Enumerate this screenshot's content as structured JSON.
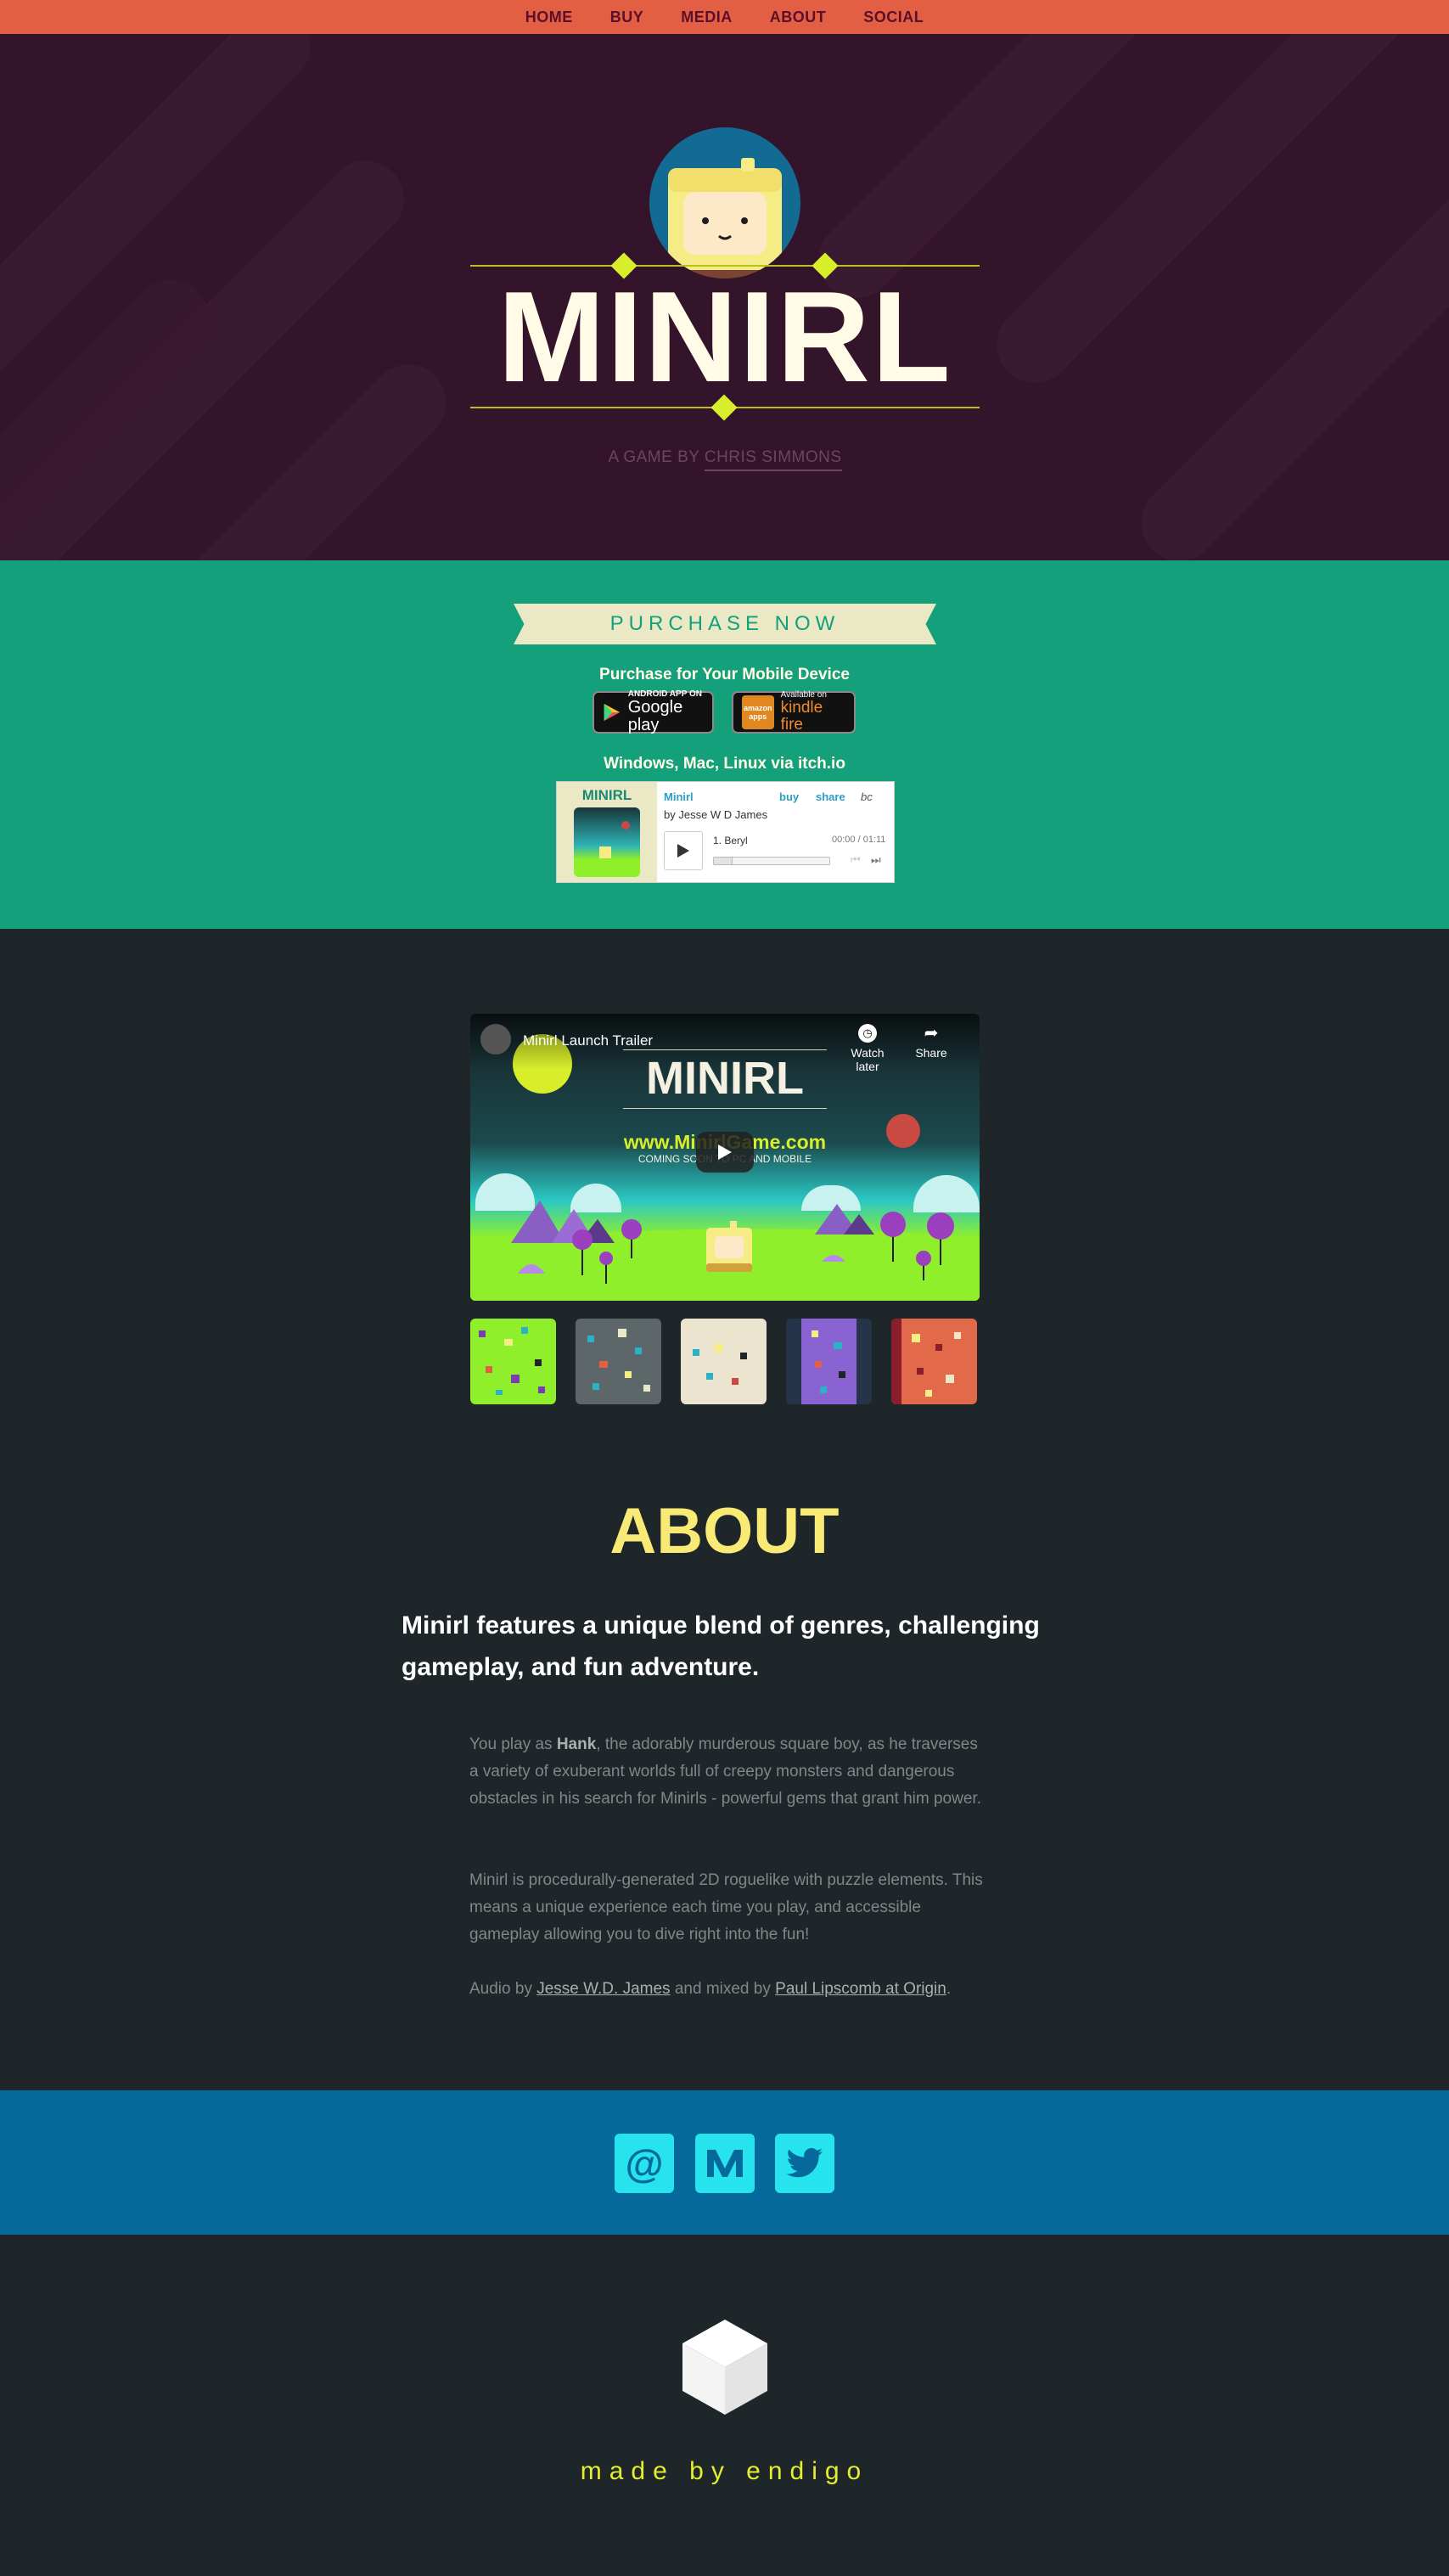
{
  "nav": {
    "items": [
      {
        "label": "HOME"
      },
      {
        "label": "BUY"
      },
      {
        "label": "MEDIA"
      },
      {
        "label": "ABOUT"
      },
      {
        "label": "SOCIAL"
      }
    ]
  },
  "hero": {
    "title": "MINIRL",
    "byline_prefix": "A GAME BY",
    "byline_author": "CHRIS SIMMONS"
  },
  "purchase": {
    "banner": "PURCHASE NOW",
    "mobile_label": "Purchase for Your Mobile Device",
    "google_play": {
      "small": "ANDROID APP ON",
      "big": "Google play"
    },
    "amazon": {
      "logo": "amazon",
      "sub": "apps",
      "small": "Available on",
      "big": "kindle fire"
    },
    "desktop_label": "Windows, Mac, Linux via itch.io",
    "player": {
      "cover_title": "MINIRL",
      "album": "Minirl",
      "buy": "buy",
      "share": "share",
      "bc_logo": "bc",
      "artist": "by Jesse W D James",
      "track": "1. Beryl",
      "time": "00:00 / 01:11"
    }
  },
  "media": {
    "video": {
      "title": "Minirl Launch Trailer",
      "watch_later": "Watch later",
      "share": "Share",
      "overlay_title": "MINIRL",
      "url": "www.MinirlGame.com",
      "coming": "COMING SOON TO PC AND MOBILE"
    },
    "thumbnails": [
      "screenshot-1",
      "screenshot-2",
      "screenshot-3",
      "screenshot-4",
      "screenshot-5"
    ]
  },
  "about": {
    "title": "ABOUT",
    "lead": "Minirl features a unique blend of genres, challenging gameplay, and fun adventure.",
    "p1_a": "You play as ",
    "p1_hank": "Hank",
    "p1_b": ", the adorably murderous square boy, as he traverses a variety of exuberant worlds full of creepy monsters and dangerous obstacles in his search for Minirls - powerful gems that grant him power.",
    "p2": "Minirl is procedurally-generated 2D roguelike with puzzle elements. This means a unique experience each time you play, and accessible gameplay allowing you to dive right into the fun!",
    "p3_a": "Audio by ",
    "p3_link1": "Jesse W.D. James",
    "p3_b": " and mixed by ",
    "p3_link2": "Paul Lipscomb at Origin",
    "p3_c": "."
  },
  "social": {
    "buttons": [
      {
        "icon": "email-icon",
        "glyph": "@"
      },
      {
        "icon": "medium-icon",
        "glyph": "M"
      },
      {
        "icon": "twitter-icon",
        "glyph": ""
      }
    ]
  },
  "footer": {
    "made_by": "made by endigo"
  },
  "colors": {
    "nav": "#e35f44",
    "hero": "#34142a",
    "purchase": "#14a07a",
    "dark": "#1e2629",
    "social": "#056a9b",
    "accent_yellow": "#f9ea76",
    "lime": "#e3ee2c"
  }
}
